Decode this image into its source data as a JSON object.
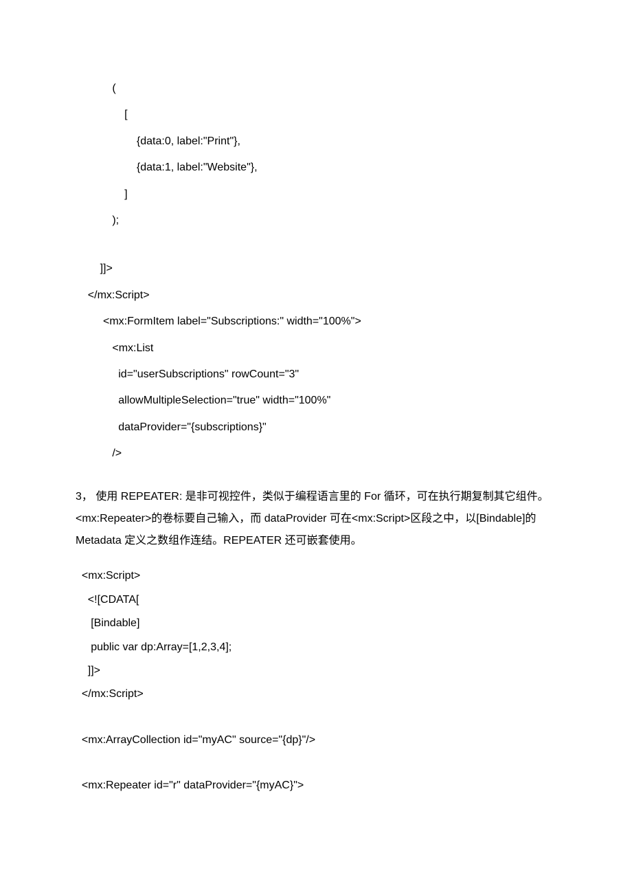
{
  "code1": {
    "l1": "            (",
    "l2": "                [",
    "l3": "                    {data:0, label:\"Print\"},",
    "l4": "                    {data:1, label:\"Website\"},",
    "l5": "                ]",
    "l6": "            );",
    "l7": "",
    "l8": "        ]]>",
    "l9": "    </mx:Script>",
    "l10": "         <mx:FormItem label=\"Subscriptions:\" width=\"100%\">",
    "l11": "            <mx:List",
    "l12": "              id=\"userSubscriptions\" rowCount=\"3\"",
    "l13": "              allowMultipleSelection=\"true\" width=\"100%\"",
    "l14": "              dataProvider=\"{subscriptions}\"",
    "l15": "            />"
  },
  "para": "3， 使用 REPEATER: 是非可视控件，类似于编程语言里的 For 循环，可在执行期复制其它组件。<mx:Repeater>的卷标要自己输入，而 dataProvider 可在<mx:Script>区段之中，以[Bindable]的 Metadata 定义之数组作连结。REPEATER 还可嵌套使用。",
  "code2": {
    "l1": "  <mx:Script>",
    "l2": "    <![CDATA[",
    "l3": "     [Bindable]",
    "l4": "     public var dp:Array=[1,2,3,4];",
    "l5": "    ]]>",
    "l6": "  </mx:Script>",
    "l7": "",
    "l8": "  <mx:ArrayCollection id=\"myAC\" source=\"{dp}\"/>",
    "l9": "",
    "l10": "  <mx:Repeater id=\"r\" dataProvider=\"{myAC}\">"
  }
}
